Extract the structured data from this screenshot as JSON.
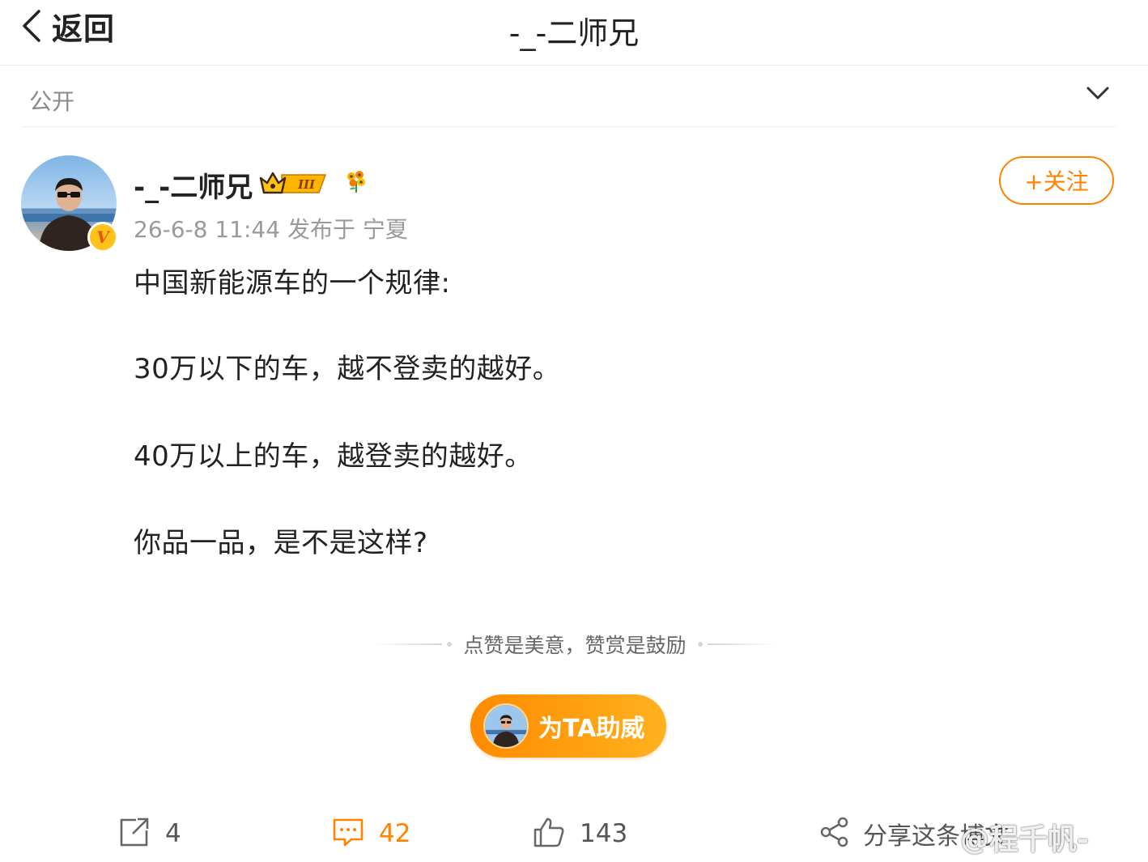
{
  "header": {
    "back_label": "返回",
    "title": "-_-二师兄"
  },
  "visibility": {
    "label": "公开"
  },
  "post": {
    "author_name": "-_-二师兄",
    "vip_level": "III",
    "meta": "26-6-8 11:44 发布于 宁夏",
    "follow_label": "+关注",
    "content": [
      "中国新能源车的一个规律:",
      "30万以下的车，越不登卖的越好。",
      "40万以上的车，越登卖的越好。",
      "你品一品，是不是这样?"
    ]
  },
  "reward": {
    "tip": "点赞是美意，赞赏是鼓励",
    "button_label": "为TA助威"
  },
  "actions": {
    "repost_count": "4",
    "comment_count": "42",
    "like_count": "143",
    "share_label": "分享这条博文"
  },
  "watermark": {
    "text": "@程千帆-"
  },
  "colors": {
    "accent": "#ff8200",
    "text": "#222222",
    "muted": "#9a9a9a"
  },
  "icons": [
    "back-chevron-icon",
    "chevron-down-icon",
    "vip-crown-icon",
    "flower-icon",
    "repost-icon",
    "comment-icon",
    "like-icon",
    "share-icon"
  ]
}
